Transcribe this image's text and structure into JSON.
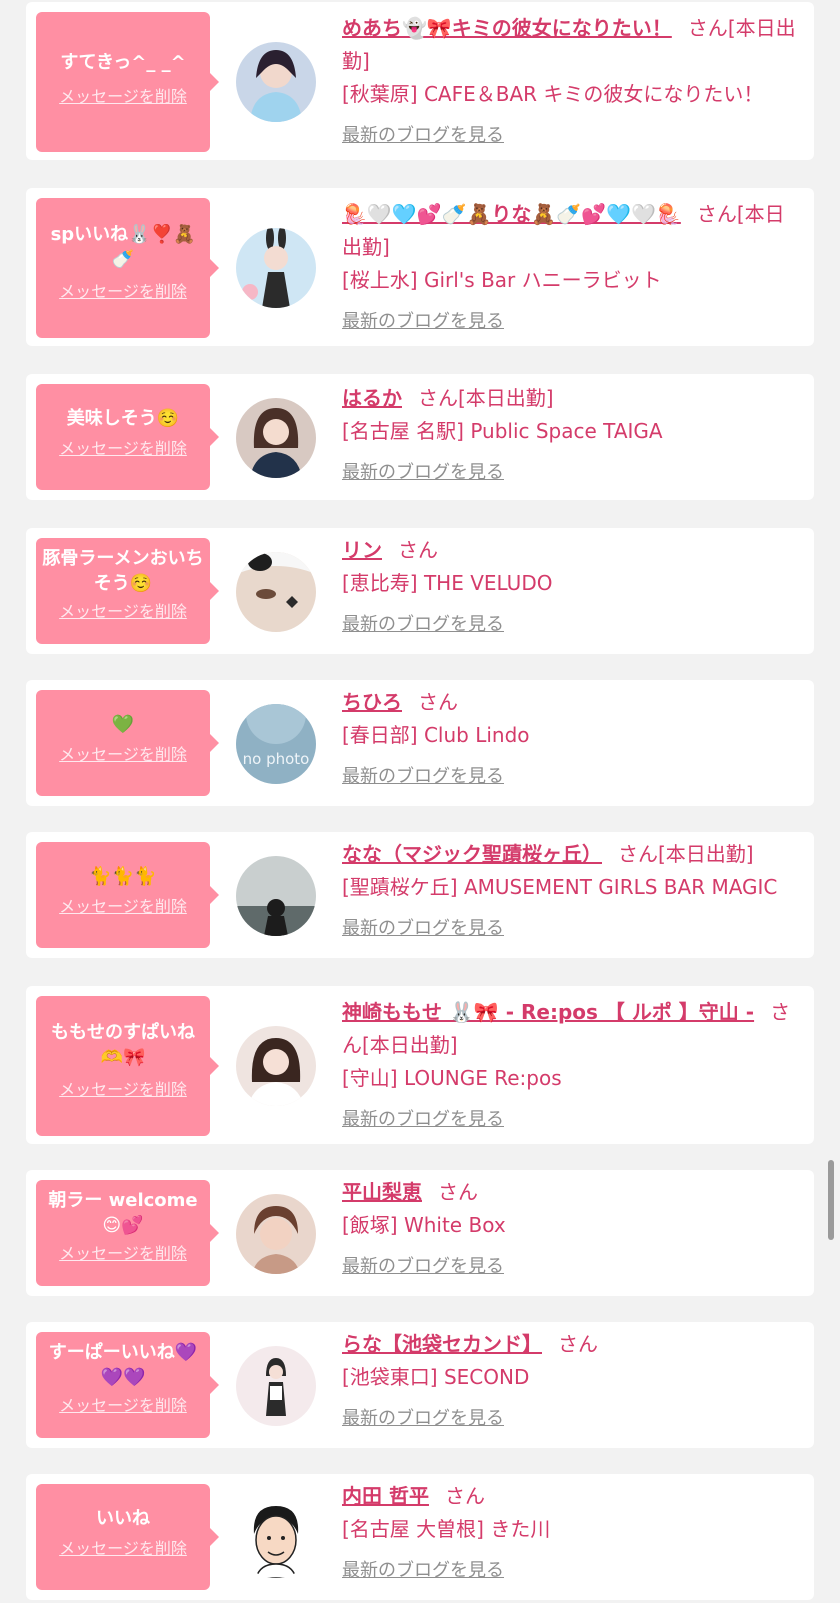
{
  "colors": {
    "page_bg": "#f2f2f2",
    "card_bg": "#ffffff",
    "bubble": "#ff8fa3",
    "accent_text": "#d43b6a",
    "blog_link": "#8f8f8f"
  },
  "labels": {
    "delete_message": "メッセージを削除",
    "view_blog": "最新のブログを見る",
    "honorific": "さん",
    "on_duty": "[本日出勤]"
  },
  "items": [
    {
      "message": "すてきっ^_ _^",
      "name": "めあち👻🎀キミの彼女になりたい！",
      "status": "[本日出勤]",
      "place": "[秋葉原] CAFE＆BAR キミの彼女になりたい！",
      "avatar_icon": "avatar-photo-icon"
    },
    {
      "message": "spいいね🐰❣️🧸🍼",
      "name": "🪼🤍🩵💕🍼🧸りな🧸🍼💕🩵🤍🪼",
      "status": "[本日出勤]",
      "place": "[桜上水] Girl's Bar ハニーラビット",
      "avatar_icon": "avatar-photo-icon"
    },
    {
      "message": "美味しそう☺️",
      "name": "はるか",
      "status": "[本日出勤]",
      "place": "[名古屋 名駅] Public Space TAIGA",
      "avatar_icon": "avatar-photo-icon"
    },
    {
      "message": "豚骨ラーメンおいちそう☺️",
      "name": "リン",
      "status": "",
      "place": "[恵比寿] THE VELUDO",
      "avatar_icon": "avatar-photo-icon"
    },
    {
      "message": "💚",
      "name": "ちひろ",
      "status": "",
      "place": "[春日部] Club Lindo",
      "avatar_icon": "no-photo-icon",
      "avatar_text": "no photo"
    },
    {
      "message": "🐈🐈🐈",
      "name": "なな（マジック聖蹟桜ヶ丘）",
      "status": "[本日出勤]",
      "place": "[聖蹟桜ケ丘] AMUSEMENT GIRLS BAR MAGIC",
      "avatar_icon": "avatar-photo-icon"
    },
    {
      "message": "ももせのすぱいね🫶🎀",
      "name": "神崎ももせ 🐰🎀 - Re:pos 【 ルポ 】守山 -",
      "status": "[本日出勤]",
      "place": "[守山] LOUNGE Re:pos",
      "avatar_icon": "avatar-photo-icon"
    },
    {
      "message": "朝ラー welcome😊💕",
      "name": "平山梨恵",
      "status": "",
      "place": "[飯塚] White Box",
      "avatar_icon": "avatar-photo-icon"
    },
    {
      "message": "すーぱーいいね💜💜💜",
      "name": "らな【池袋セカンド】",
      "status": "",
      "place": "[池袋東口] SECOND",
      "avatar_icon": "avatar-photo-icon"
    },
    {
      "message": "いいね",
      "name": "内田 哲平",
      "status": "",
      "place": "[名古屋 大曽根] きた川",
      "avatar_icon": "avatar-illustration-icon"
    }
  ]
}
